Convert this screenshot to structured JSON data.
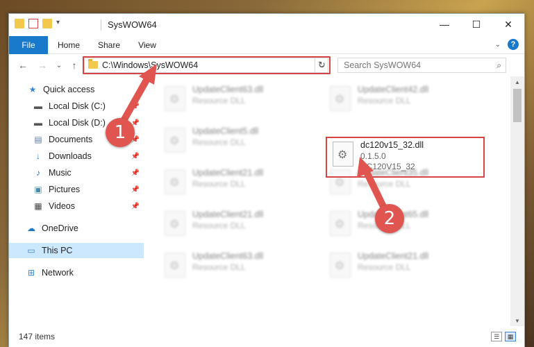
{
  "window": {
    "title": "SysWOW64",
    "controls": {
      "minimize": "—",
      "maximize": "☐",
      "close": "✕"
    }
  },
  "ribbon": {
    "tabs": [
      "File",
      "Home",
      "Share",
      "View"
    ],
    "help": "?"
  },
  "address": {
    "path": "C:\\Windows\\SysWOW64",
    "search_placeholder": "Search SysWOW64"
  },
  "nav": {
    "items": [
      {
        "label": "Quick access",
        "icon": "star-icon",
        "pinned": false
      },
      {
        "label": "Local Disk (C:)",
        "icon": "drive-icon",
        "pinned": true
      },
      {
        "label": "Local Disk (D:)",
        "icon": "drive-icon",
        "pinned": true
      },
      {
        "label": "Documents",
        "icon": "document-icon",
        "pinned": true
      },
      {
        "label": "Downloads",
        "icon": "download-icon",
        "pinned": true
      },
      {
        "label": "Music",
        "icon": "music-icon",
        "pinned": true
      },
      {
        "label": "Pictures",
        "icon": "pictures-icon",
        "pinned": true
      },
      {
        "label": "Videos",
        "icon": "videos-icon",
        "pinned": true
      },
      {
        "label": "OneDrive",
        "icon": "cloud-icon",
        "pinned": false
      },
      {
        "label": "This PC",
        "icon": "computer-icon",
        "pinned": false,
        "selected": true
      },
      {
        "label": "Network",
        "icon": "network-icon",
        "pinned": false
      }
    ]
  },
  "files": [
    {
      "name": "UpdateClient63.dll",
      "type": "Resource DLL"
    },
    {
      "name": "UpdateClient42.dll",
      "type": "Resource DLL"
    },
    {
      "name": "UpdateClient5.dll",
      "type": "Resource DLL"
    },
    {
      "name": "dc120v15_32.dll",
      "version": "0.1.5.0",
      "description": "DC120V15_32"
    },
    {
      "name": "UpdateClient21.dll",
      "type": "Resource DLL"
    },
    {
      "name": "UpdateClient35.dll",
      "type": "Resource DLL"
    },
    {
      "name": "UpdateClient21.dll",
      "type": "Resource DLL"
    },
    {
      "name": "UpdateClient65.dll",
      "type": "Resource DLL"
    },
    {
      "name": "UpdateClient63.dll",
      "type": "Resource DLL"
    },
    {
      "name": "UpdateClient21.dll",
      "type": "Resource DLL"
    }
  ],
  "status": {
    "item_count": "147 items"
  },
  "annotations": {
    "step1": "1",
    "step2": "2",
    "color": "#e0554f"
  }
}
